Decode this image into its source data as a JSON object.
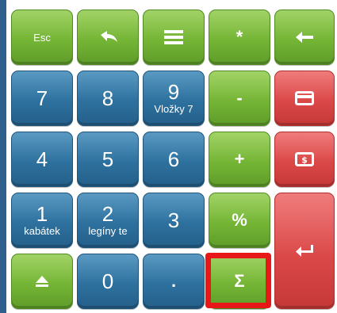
{
  "keys": {
    "esc": "Esc",
    "star": "*",
    "minus": "-",
    "plus": "+",
    "percent": "%",
    "sigma": "Σ",
    "dot": ".",
    "n7": "7",
    "n8": "8",
    "n9": "9",
    "n9_sub": "Vložky 7",
    "n4": "4",
    "n5": "5",
    "n6": "6",
    "n1": "1",
    "n1_sub": "kabátek",
    "n2": "2",
    "n2_sub": "legíny te",
    "n3": "3",
    "n0": "0"
  },
  "icons": {
    "undo": "undo-icon",
    "list": "list-icon",
    "backspace": "backspace-arrow-icon",
    "card": "card-payment-icon",
    "cash": "cash-payment-icon",
    "enter": "enter-icon",
    "eject": "eject-icon"
  },
  "colors": {
    "blue": "#2d6f9c",
    "green": "#72b334",
    "red": "#d94646",
    "highlight": "#e81818"
  }
}
